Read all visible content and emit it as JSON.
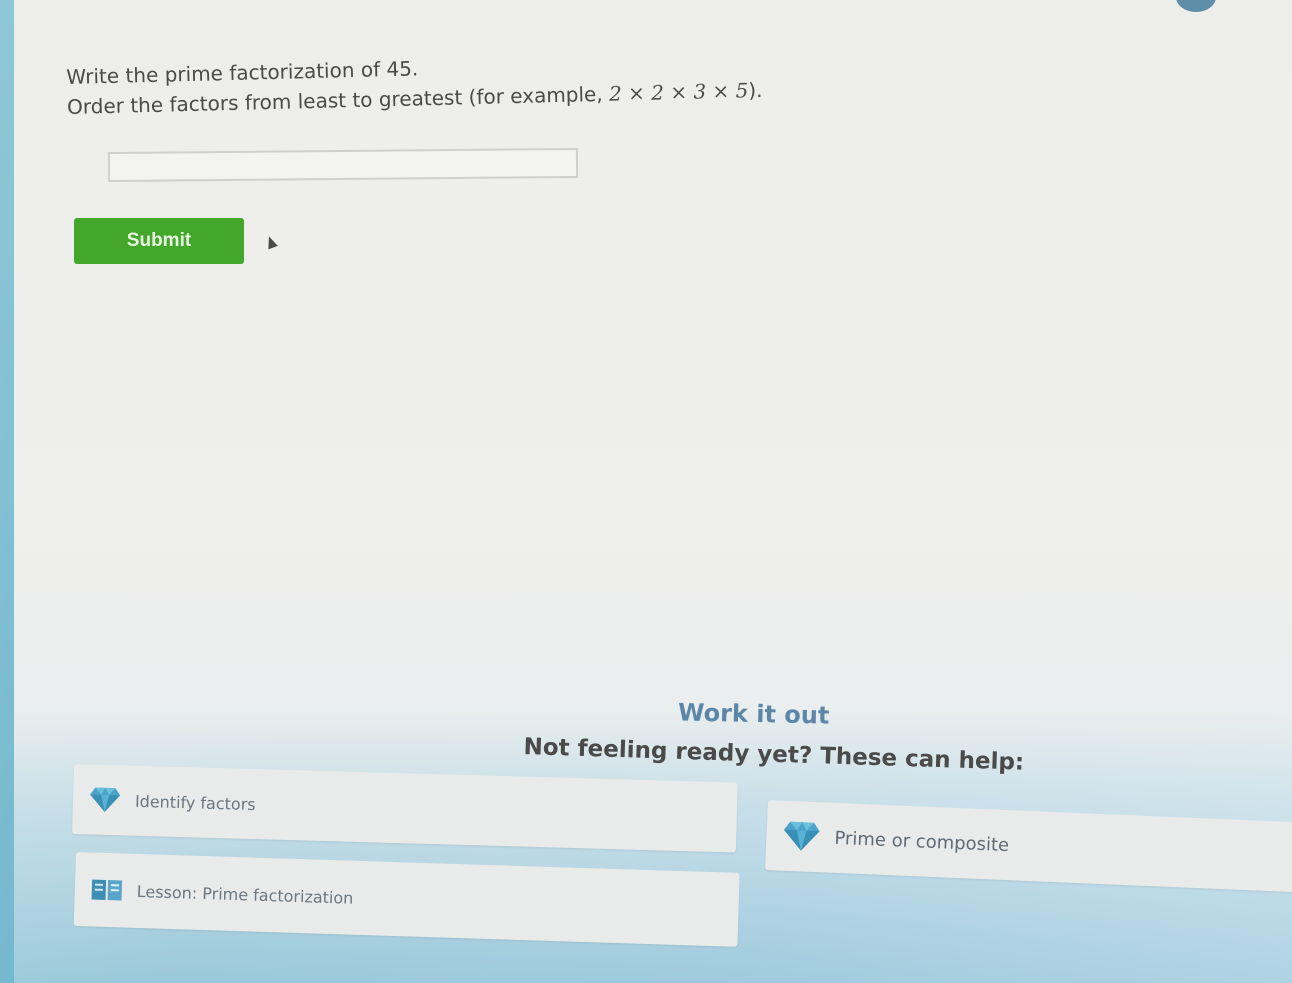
{
  "question": {
    "line1": "Write the prime factorization of 45.",
    "line2_text": "Order the factors from least to greatest (for example, ",
    "line2_math": "2 × 2 × 3 × 5",
    "line2_end": ")."
  },
  "answer": {
    "value": "",
    "placeholder": ""
  },
  "submit": {
    "label": "Submit",
    "color": "#42a72a"
  },
  "help": {
    "title": "Work it out",
    "subtitle": "Not feeling ready yet? These can help:",
    "items": [
      {
        "label": "Identify factors",
        "icon": "diamond-icon"
      },
      {
        "label": "Prime or composite",
        "icon": "diamond-icon"
      },
      {
        "label": "Lesson: Prime factorization",
        "icon": "lesson-book-icon"
      }
    ]
  },
  "colors": {
    "accent_blue": "#5c86a8",
    "diamond": "#4aa3c8"
  }
}
